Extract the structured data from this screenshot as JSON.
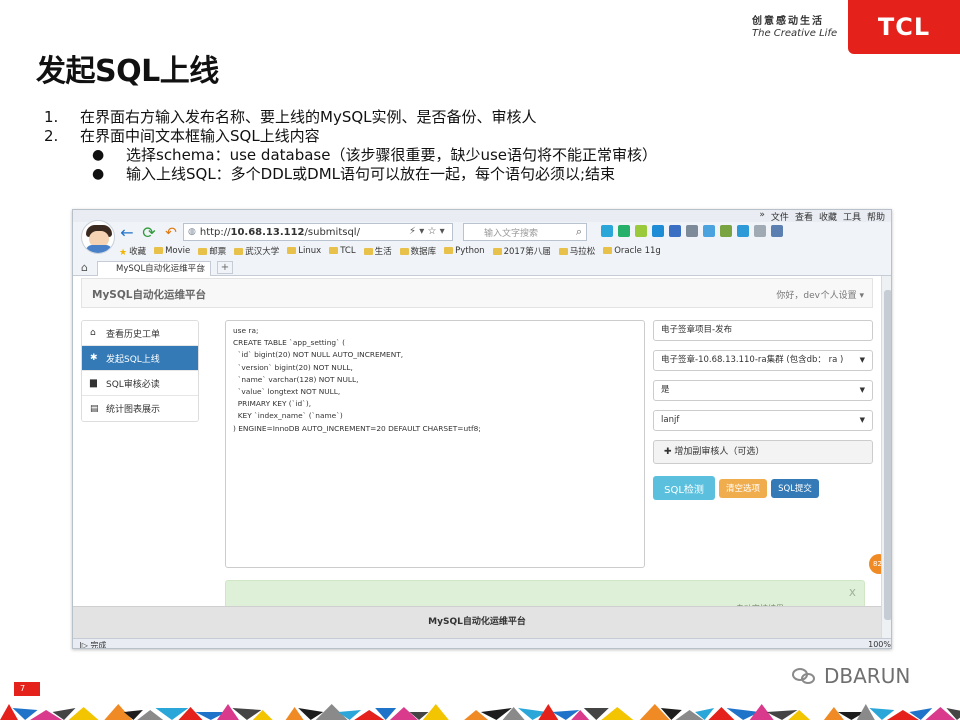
{
  "slide": {
    "title": "发起SQL上线",
    "brand_slogan_cn": "创意感动生活",
    "brand_slogan_en": "The Creative Life",
    "logo_text": "TCL",
    "page_number": "7",
    "watermark": "DBARUN",
    "steps": [
      {
        "num": "1.",
        "text": "在界面右方输入发布名称、要上线的MySQL实例、是否备份、审核人"
      },
      {
        "num": "2.",
        "text": "在界面中间文本框输入SQL上线内容"
      }
    ],
    "sub_bullets": [
      {
        "marker": "●",
        "text": "选择schema：use database（该步骤很重要，缺少use语句将不能正常审核）"
      },
      {
        "marker": "●",
        "text": "输入上线SQL：多个DDL或DML语句可以放在一起，每个语句必须以;结束"
      }
    ]
  },
  "browser": {
    "top_links": [
      "»",
      "文件",
      "查看",
      "收藏",
      "工具",
      "帮助"
    ],
    "url_prefix": "http://",
    "url_host": "10.68.13.112",
    "url_path": "/submitsql/",
    "search_placeholder": "输入文字搜索",
    "bookmarks": [
      "收藏",
      "Movie",
      "邮票",
      "武汉大学",
      "Linux",
      "TCL",
      "生活",
      "数据库",
      "Python",
      "2017第八届",
      "马拉松",
      "Oracle 11g"
    ],
    "tab_title": "MySQL自动化运维平台",
    "tab_close": "×",
    "new_tab": "+",
    "status_left": "完成",
    "zoom": "100%"
  },
  "app": {
    "brand": "MySQL自动化运维平台",
    "greeting": "你好，dev",
    "user_menu": "个人设置",
    "sidebar": [
      {
        "label": "查看历史工单",
        "icon": "home-icon",
        "active": false
      },
      {
        "label": "发起SQL上线",
        "icon": "asterisk-icon",
        "active": true
      },
      {
        "label": "SQL审核必读",
        "icon": "book-icon",
        "active": false
      },
      {
        "label": "统计图表展示",
        "icon": "file-icon",
        "active": false
      }
    ],
    "sql_content": "use ra;\nCREATE TABLE `app_setting` (\n  `id` bigint(20) NOT NULL AUTO_INCREMENT,\n  `version` bigint(20) NOT NULL,\n  `name` varchar(128) NOT NULL,\n  `value` longtext NOT NULL,\n  PRIMARY KEY (`id`),\n  KEY `index_name` (`name`)\n) ENGINE=InnoDB AUTO_INCREMENT=20 DEFAULT CHARSET=utf8;",
    "form": {
      "release_name": "电子签章项目-发布",
      "instance": "电子签章-10.68.13.110-ra集群 (包含db： ra )",
      "backup": "是",
      "reviewer": "lanjf",
      "add_reviewer": "增加副审核人（可选）"
    },
    "buttons": {
      "check": "SQL检测",
      "clear": "清空选项",
      "submit": "SQL提交"
    },
    "alert_close": "x",
    "alert_text": "自动审核结果 ...",
    "footer": "MySQL自动化运维平台",
    "badge": "82"
  },
  "colors": {
    "tcl_red": "#e4221b",
    "primary_blue": "#337ab7",
    "info_cyan": "#5bc0de",
    "warning_orange": "#f0ad4e",
    "success_bg": "#dff0d8"
  }
}
